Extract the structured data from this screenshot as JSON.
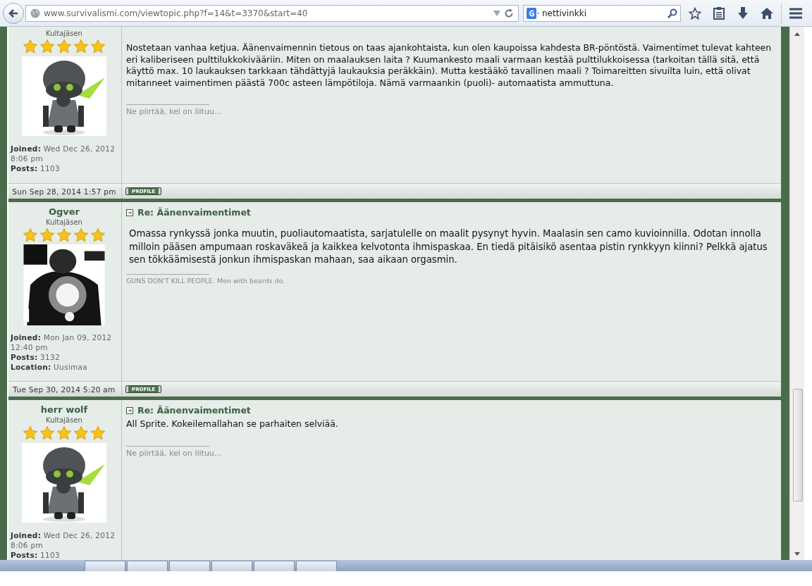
{
  "browser": {
    "url": "www.survivalismi.com/viewtopic.php?f=14&t=3370&start=40",
    "search": "nettivinkki"
  },
  "posts": [
    {
      "rank": "Kultajäsen",
      "stars": 5,
      "profile": [
        {
          "label": "Joined:",
          "value": "Wed Dec 26, 2012 8:06 pm"
        },
        {
          "label": "Posts:",
          "value": "1103"
        }
      ],
      "body": "Nostetaan vanhaa ketjua. Äänenvaimennin tietous on taas ajankohtaista, kun olen kaupoissa kahdesta BR-pöntöstä. Vaimentimet tulevat kahteen eri kaliberiseen pulttilukkokivääriin. Miten on maalauksen laita ? Kuumankesto maali varmaan kestää pulttilukkoisessa (tarkoitan tällä sitä, että käyttö max. 10 laukauksen tarkkaan tähdättyjä laukauksia peräkkäin). Mutta kestääkö tavallinen maali ? Toimareitten sivuilta luin, että olivat mitanneet vaimentimen päästä 700c asteen lämpötiloja. Nämä varmaankin (puoli)- automaatista ammuttuna.",
      "signature": "Ne piirtää, kel on liituu...",
      "date": "Sun Sep 28, 2014 1:57 pm",
      "button": "PROFILE"
    },
    {
      "author": "Ogver",
      "title": "Re: Äänenvaimentimet",
      "rank": "Kultajäsen",
      "stars": 5,
      "profile": [
        {
          "label": "Joined:",
          "value": "Mon Jan 09, 2012 12:40 pm"
        },
        {
          "label": "Posts:",
          "value": "3132"
        },
        {
          "label": "Location:",
          "value": "Uusimaa"
        }
      ],
      "body": "Omassa rynkyssä jonka muutin, puoliautomaatista, sarjatulelle on maalit pysynyt hyvin. Maalasin sen camo kuvioinnilla. Odotan innolla milloin pääsen ampumaan roskaväkeä ja kaikkea kelvotonta ihmispaskaa. En tiedä pitäisikö asentaa pistin rynkkyyn kiinni? Pelkkä ajatus sen tökkäämisestä jonkun ihmispaskan mahaan, saa aikaan orgasmin.",
      "signature": "GUNS DON'T KILL PEOPLE. Men with beards do.",
      "date": "Tue Sep 30, 2014 5:20 am",
      "button": "PROFILE"
    },
    {
      "author": "herr wolf",
      "title": "Re: Äänenvaimentimet",
      "rank": "Kultajäsen",
      "stars": 5,
      "profile": [
        {
          "label": "Joined:",
          "value": "Wed Dec 26, 2012 8:06 pm"
        },
        {
          "label": "Posts:",
          "value": "1103"
        }
      ],
      "body": "All Sprite. Kokeilemallahan se parhaiten selviää.",
      "signature": "Ne piirtää, kel on liituu..."
    }
  ]
}
